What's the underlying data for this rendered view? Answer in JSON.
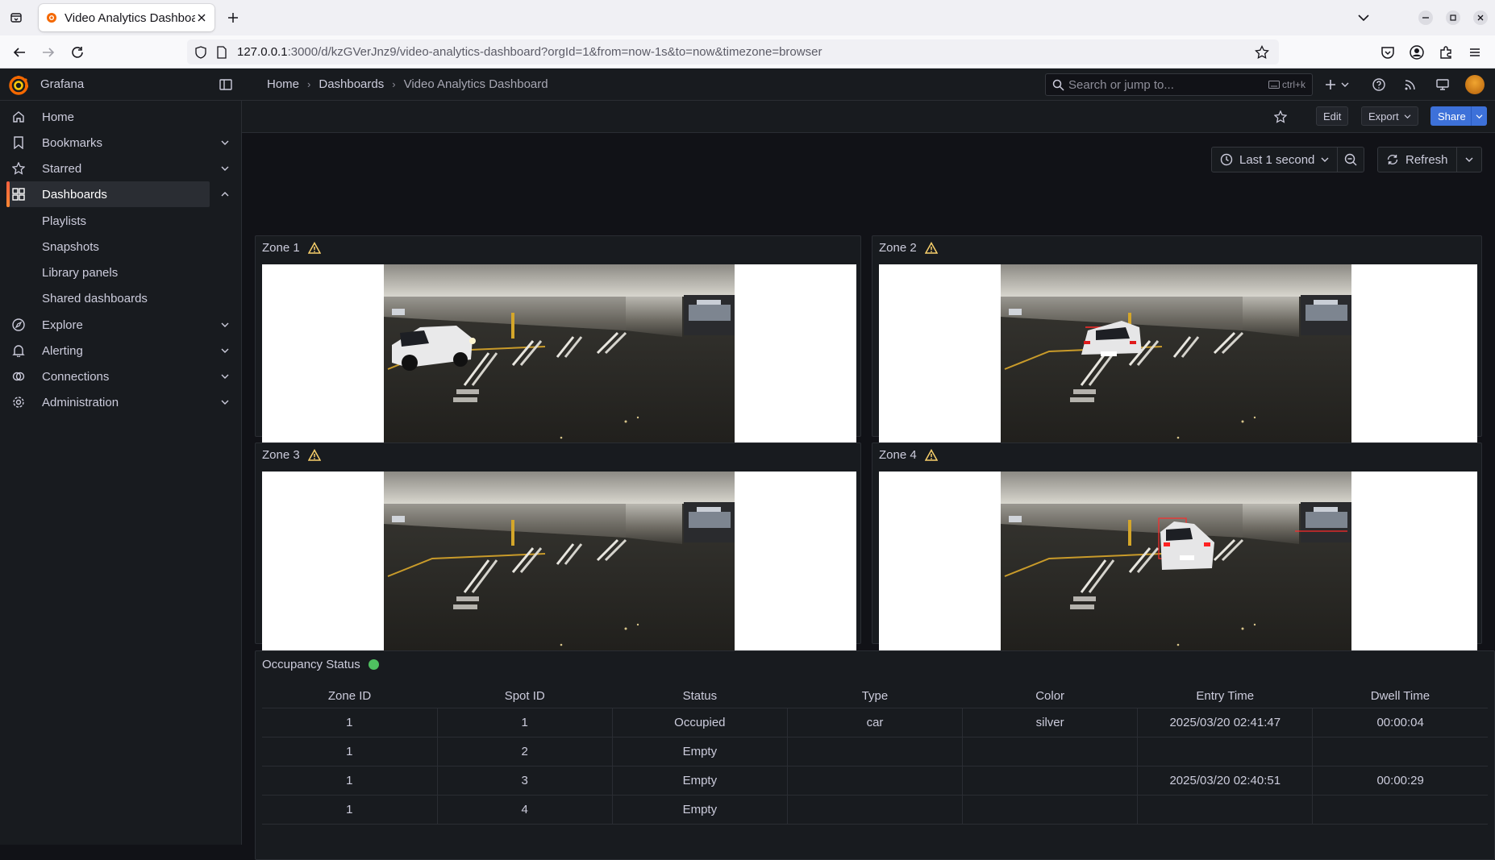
{
  "browser": {
    "tab_title": "Video Analytics Dashboar",
    "url_host": "127.0.0.1",
    "url_rest": ":3000/d/kzGVerJnz9/video-analytics-dashboard?orgId=1&from=now-1s&to=now&timezone=browser"
  },
  "grafana": {
    "brand": "Grafana",
    "breadcrumb": [
      "Home",
      "Dashboards",
      "Video Analytics Dashboard"
    ],
    "search_placeholder": "Search or jump to...",
    "search_shortcut": "ctrl+k",
    "toolbar": {
      "edit": "Edit",
      "export": "Export",
      "share": "Share"
    }
  },
  "sidebar": {
    "items": [
      {
        "label": "Home",
        "icon": "home-icon"
      },
      {
        "label": "Bookmarks",
        "icon": "bookmark-icon"
      },
      {
        "label": "Starred",
        "icon": "star-icon"
      },
      {
        "label": "Dashboards",
        "icon": "apps-icon"
      },
      {
        "label": "Explore",
        "icon": "compass-icon"
      },
      {
        "label": "Alerting",
        "icon": "bell-icon"
      },
      {
        "label": "Connections",
        "icon": "connections-icon"
      },
      {
        "label": "Administration",
        "icon": "cog-icon"
      }
    ],
    "subitems": [
      "Playlists",
      "Snapshots",
      "Library panels",
      "Shared dashboards"
    ]
  },
  "timepicker": {
    "range": "Last 1 second",
    "refresh": "Refresh"
  },
  "panels": {
    "zones": [
      "Zone 1",
      "Zone 2",
      "Zone 3",
      "Zone 4"
    ],
    "occupancy_title": "Occupancy Status"
  },
  "table": {
    "headers": [
      "Zone ID",
      "Spot ID",
      "Status",
      "Type",
      "Color",
      "Entry Time",
      "Dwell Time"
    ],
    "rows": [
      [
        "1",
        "1",
        "Occupied",
        "car",
        "silver",
        "2025/03/20 02:41:47",
        "00:00:04"
      ],
      [
        "1",
        "2",
        "Empty",
        "",
        "",
        "",
        ""
      ],
      [
        "1",
        "3",
        "Empty",
        "",
        "",
        "2025/03/20 02:40:51",
        "00:00:29"
      ],
      [
        "1",
        "4",
        "Empty",
        "",
        "",
        "",
        ""
      ]
    ]
  },
  "colors": {
    "accent_orange": "#ff8833",
    "primary_blue": "#3d71d9",
    "warning": "#f8d06b",
    "status_ok": "#4fc160"
  }
}
